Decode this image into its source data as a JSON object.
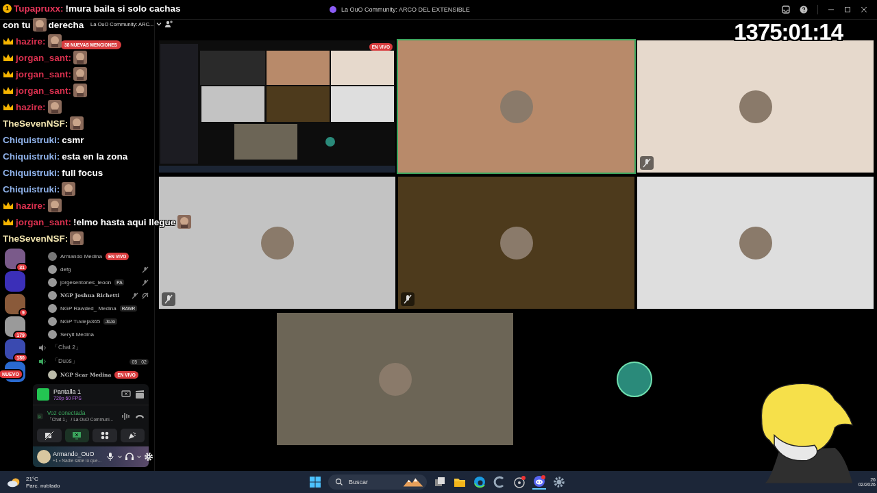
{
  "window": {
    "title": "La OuO Community: ARCO DEL EXTENSIBLE"
  },
  "stream_timer": "1375:01:14",
  "chat": [
    {
      "user": "Tupapruxx:",
      "color": "#e8365a",
      "crown": false,
      "badge": "1",
      "parts": [
        {
          "kind": "text",
          "text": "!mura baila si solo cachas"
        }
      ]
    },
    {
      "parts": [
        {
          "kind": "text",
          "text": "con tu"
        },
        {
          "kind": "emote"
        },
        {
          "kind": "text",
          "text": "derecha"
        }
      ]
    },
    {
      "user": "hazire:",
      "color": "#d8304e",
      "crown": true,
      "parts": [
        {
          "kind": "emote"
        }
      ]
    },
    {
      "user": "jorgan_sant:",
      "color": "#d8304e",
      "crown": true,
      "parts": [
        {
          "kind": "emote"
        }
      ]
    },
    {
      "user": "jorgan_sant:",
      "color": "#d8304e",
      "crown": true,
      "parts": [
        {
          "kind": "emote"
        }
      ]
    },
    {
      "user": "jorgan_sant:",
      "color": "#d8304e",
      "crown": true,
      "parts": [
        {
          "kind": "emote"
        }
      ]
    },
    {
      "user": "hazire:",
      "color": "#d8304e",
      "crown": true,
      "parts": [
        {
          "kind": "emote"
        }
      ]
    },
    {
      "user": "TheSevenNSF:",
      "color": "#f3e6b0",
      "crown": false,
      "parts": [
        {
          "kind": "emote"
        }
      ]
    },
    {
      "user": "Chiquistruki:",
      "color": "#8fb2ea",
      "crown": false,
      "parts": [
        {
          "kind": "text",
          "text": "csmr"
        }
      ]
    },
    {
      "user": "Chiquistruki:",
      "color": "#8fb2ea",
      "crown": false,
      "parts": [
        {
          "kind": "text",
          "text": "esta en la zona"
        }
      ]
    },
    {
      "user": "Chiquistruki:",
      "color": "#8fb2ea",
      "crown": false,
      "parts": [
        {
          "kind": "text",
          "text": "full focus"
        }
      ]
    },
    {
      "user": "Chiquistruki:",
      "color": "#8fb2ea",
      "crown": false,
      "parts": [
        {
          "kind": "emote"
        }
      ]
    },
    {
      "user": "hazire:",
      "color": "#d8304e",
      "crown": true,
      "parts": [
        {
          "kind": "emote"
        }
      ]
    },
    {
      "user": "jorgan_sant:",
      "color": "#d8304e",
      "crown": true,
      "parts": [
        {
          "kind": "text",
          "text": "!elmo hasta aqui llegue"
        },
        {
          "kind": "emote"
        }
      ]
    },
    {
      "user": "TheSevenNSF:",
      "color": "#f3e6b0",
      "crown": false,
      "parts": [
        {
          "kind": "emote"
        }
      ]
    }
  ],
  "servers": [
    {
      "color": "#7a5a8a",
      "badge": "31"
    },
    {
      "color": "#3b2fb8"
    },
    {
      "color": "#8a5a3a",
      "badge": "9"
    },
    {
      "color": "#9a9a9a",
      "badge": "179"
    },
    {
      "color": "#3a4ab0",
      "badge": "180"
    },
    {
      "color": "#2a6ad0",
      "badge": "NUEVO"
    }
  ],
  "server_name": "La OuO Community: ARC...",
  "mentions_pill": "38 NUEVAS MENCIONES",
  "streamer": {
    "name": "Armando Medina",
    "live": "EN VIVO"
  },
  "members": [
    {
      "name": "defg",
      "muted": true,
      "deafened": false,
      "bold": false
    },
    {
      "name": "jorgesentones_leoon",
      "tag": "PA",
      "muted": true,
      "deafened": false,
      "bold": false
    },
    {
      "name": "NGP Joshua Richetti",
      "muted": true,
      "deafened": true,
      "bold": true
    },
    {
      "name": "NGP Rawded_ Medina",
      "tag": "RAWR",
      "muted": false,
      "deafened": false,
      "bold": false
    },
    {
      "name": "NGP Tuvieja365",
      "tag": "JoJo",
      "muted": false,
      "deafened": false,
      "bold": false
    },
    {
      "name": "Seryit Medina",
      "muted": false,
      "deafened": false,
      "bold": false
    }
  ],
  "voice_channels": [
    {
      "name": "「Chat 2」",
      "active": false
    },
    {
      "name": "「Duos」",
      "active": true,
      "counter": [
        "05",
        "02"
      ]
    }
  ],
  "live_member": {
    "name": "NGP Scar Medina",
    "live": "EN VIVO"
  },
  "screen_share": {
    "title": "Pantalla 1",
    "quality": "720p 60 FPS"
  },
  "voice_status": {
    "title": "Voz conectada",
    "channel": "「Chat 1」 / La OuO Communi..."
  },
  "user": {
    "name": "Armando_OuO",
    "status": "+1 • Nadie sabe lo que..."
  },
  "tiles": [
    {
      "kind": "screen",
      "color": "#111111",
      "live": "EN VIVO",
      "speaking": false,
      "muted": false
    },
    {
      "kind": "camera",
      "color": "#b88a6a",
      "speaking": true,
      "muted": false
    },
    {
      "kind": "camera",
      "color": "#e6d9cc",
      "speaking": false,
      "muted": true
    },
    {
      "kind": "camera",
      "color": "#c3c3c3",
      "speaking": false,
      "muted": true
    },
    {
      "kind": "camera",
      "color": "#4d3a1c",
      "speaking": false,
      "muted": true
    },
    {
      "kind": "camera",
      "color": "#dedede",
      "speaking": false,
      "muted": false
    },
    {
      "kind": "camera",
      "color": "#6c6556",
      "speaking": false,
      "muted": false
    },
    {
      "kind": "camera",
      "color": "#000000",
      "speaking": false,
      "muted": false
    }
  ],
  "taskbar": {
    "temperature": "21°C",
    "weather": "Parc. nublado",
    "search_placeholder": "Buscar",
    "clock_time": "26",
    "clock_date": "02/2026"
  }
}
